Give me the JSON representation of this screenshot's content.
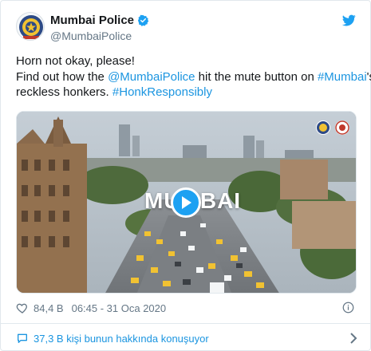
{
  "author": {
    "display_name": "Mumbai Police",
    "handle": "@MumbaiPolice"
  },
  "tweet": {
    "line1": "Horn not okay, please!",
    "line2_a": "Find out how the ",
    "line2_mention": "@MumbaiPolice",
    "line2_b": " hit the mute button on ",
    "line2_hashtag": "#Mumbai",
    "line2_c": "'s",
    "line3_a": "reckless honkers. ",
    "line3_hashtag": "#HonkResponsibly"
  },
  "media": {
    "overlay_title": "MUMBAI",
    "play_icon": "play-icon"
  },
  "meta": {
    "likes": "84,4 B",
    "timestamp": "06:45 - 31 Oca 2020"
  },
  "footer": {
    "discussion_label": "37,3 B kişi bunun hakkında konuşuyor"
  },
  "colors": {
    "link": "#1b95e0",
    "twitter_blue": "#1da1f2",
    "muted": "#657786",
    "border": "#e1e8ed"
  }
}
